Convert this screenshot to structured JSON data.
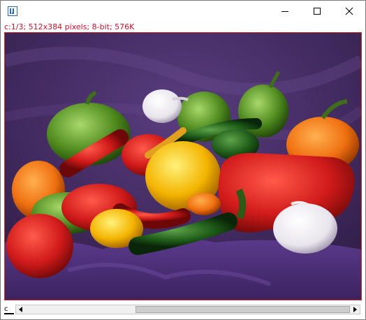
{
  "window": {
    "buttons": {
      "minimize": "minimize-icon",
      "maximize": "maximize-icon",
      "close": "close-icon"
    }
  },
  "image_info": {
    "text": "c:1/3; 512x384 pixels; 8-bit; 576K"
  },
  "channel_slider": {
    "label": "c",
    "position_fraction": 0.36
  },
  "colors": {
    "info_text": "#c8102e",
    "canvas_border": "#c0392b",
    "background_cloth": "#4a2f6b"
  }
}
